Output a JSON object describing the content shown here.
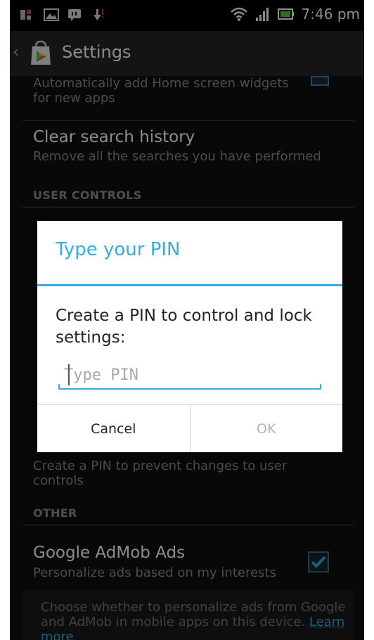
{
  "status_bar": {
    "time": "7:46 pm",
    "icons": [
      "notification-icon",
      "gallery-icon",
      "message-icon",
      "download-icon",
      "wifi-icon",
      "signal-icon",
      "battery-icon"
    ]
  },
  "action_bar": {
    "title": "Settings",
    "icon": "play-store-icon"
  },
  "settings": {
    "auto_widgets_subtitle": "Automatically add Home screen widgets for new apps",
    "clear_history": {
      "title": "Clear search history",
      "subtitle": "Remove all the searches you have performed"
    },
    "user_controls_header": "USER CONTROLS",
    "pin_subtitle": "Create a PIN to prevent changes to user controls",
    "other_header": "OTHER",
    "admob": {
      "title": "Google AdMob Ads",
      "subtitle": "Personalize ads based on my interests",
      "checked": true
    },
    "admob_info": "Choose whether to personalize ads from Google and AdMob in mobile apps on this device.",
    "learn_more": "Learn more"
  },
  "dialog": {
    "title": "Type your PIN",
    "message": "Create a PIN to control and lock settings:",
    "pin_value": "",
    "pin_placeholder": "Type PIN",
    "cancel_label": "Cancel",
    "ok_label": "OK"
  },
  "colors": {
    "accent": "#33aee3",
    "background": "#101010",
    "dialog_bg": "#ffffff",
    "link": "#33aee3"
  }
}
